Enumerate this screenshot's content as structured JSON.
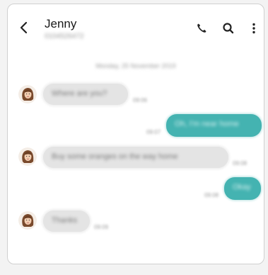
{
  "header": {
    "contact_name": "Jenny",
    "contact_number": "0104526472",
    "back_icon": "back-arrow-icon",
    "call_icon": "phone-icon",
    "search_icon": "search-icon",
    "more_icon": "more-vert-icon"
  },
  "conversation": {
    "date": "Monday, 25 November 2019",
    "messages": [
      {
        "direction": "incoming",
        "text": "Where are you?",
        "time": "09:06"
      },
      {
        "direction": "outgoing",
        "text": "Oh, I'm near home",
        "time": "09:07"
      },
      {
        "direction": "incoming",
        "text": "Buy some oranges on the way home",
        "time": "09:08"
      },
      {
        "direction": "outgoing",
        "text": "Okay",
        "time": "09:08"
      },
      {
        "direction": "incoming",
        "text": "Thanks",
        "time": "09:09"
      }
    ]
  },
  "colors": {
    "outgoing_bubble": "#44b3b1",
    "incoming_bubble": "#e4e4e4"
  }
}
